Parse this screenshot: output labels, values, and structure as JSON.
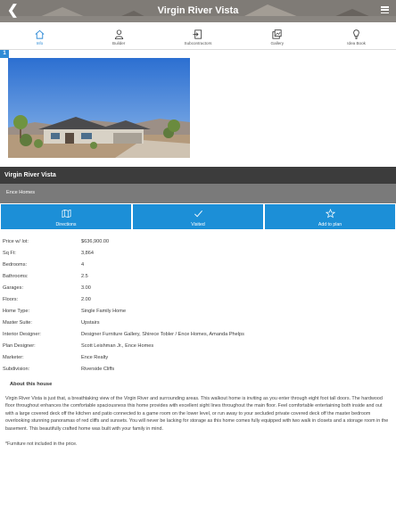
{
  "header": {
    "title": "Virgin River Vista"
  },
  "tabs": [
    {
      "label": "Info",
      "icon": "home-icon",
      "active": true
    },
    {
      "label": "Builder",
      "icon": "person-icon",
      "active": false
    },
    {
      "label": "Subcontractors",
      "icon": "door-enter-icon",
      "active": false
    },
    {
      "label": "Gallery",
      "icon": "gallery-icon",
      "active": false
    },
    {
      "label": "Idea Book",
      "icon": "lightbulb-icon",
      "active": false
    }
  ],
  "photo": {
    "counter": "1"
  },
  "home_name": "Virgin River Vista",
  "builder_name": "Ence Homes",
  "actions": [
    {
      "label": "Directions",
      "icon": "map-icon"
    },
    {
      "label": "Visited",
      "icon": "checkmark-icon"
    },
    {
      "label": "Add to plan",
      "icon": "star-icon"
    }
  ],
  "details": [
    {
      "key": "Price w/ lot:",
      "value": "$636,900.00"
    },
    {
      "key": "Sq Ft:",
      "value": "3,864"
    },
    {
      "key": "Bedrooms:",
      "value": "4"
    },
    {
      "key": "Bathrooms:",
      "value": "2.5"
    },
    {
      "key": "Garages:",
      "value": "3.00"
    },
    {
      "key": "Floors:",
      "value": "2.00"
    },
    {
      "key": "Home Type:",
      "value": "Single Family Home"
    },
    {
      "key": "Master Suite:",
      "value": "Upstairs"
    },
    {
      "key": "Interior Designer:",
      "value": "Designer Furniture Gallery, Shirece Tobler / Ence Homes, Amanda Phelps"
    },
    {
      "key": "Plan Designer:",
      "value": "Scott Leishman Jr., Ence Homes"
    },
    {
      "key": "Marketer:",
      "value": "Ence Realty"
    },
    {
      "key": "Subdivision:",
      "value": "Riverside Cliffs"
    }
  ],
  "about": {
    "title": "About this house",
    "text": "Virgin River Vista is just that, a breathtaking view of the Virgin River and surrounding areas. This walkout home is inviting as you enter through eight foot tall doors. The hardwood floor throughout enhances the comfortable spaciousness this home provides with excellent sight lines throughout the main floor. Feel comfortable entertaining both inside and out with a large covered deck off the kitchen and patio connected to a game room on the lower level, or run away to your secluded private covered deck off the master bedroom overlooking stunning panoramas of red cliffs and sunsets. You will never be lacking for storage as this home comes fully equipped with two walk in closets and a storage room in the basement. This beautifully crafted home was built with your family in mind.",
    "note": "*Furniture not included in the price."
  },
  "colors": {
    "accent": "#1c8fd7",
    "dark_bar": "#3c3c3c",
    "gray_bar": "#7a7a7a"
  }
}
